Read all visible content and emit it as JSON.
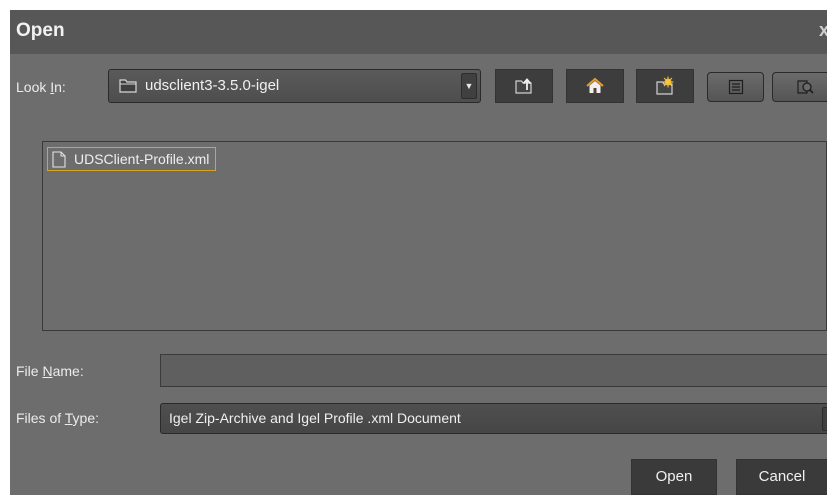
{
  "dialog": {
    "title": "Open",
    "close_glyph": "x"
  },
  "look_in": {
    "label_before": "Look ",
    "label_mnemonic": "I",
    "label_after": "n:",
    "selected_folder": "udsclient3-3.5.0-igel",
    "folder_icon": "folder-icon",
    "dropdown_glyph": "▼"
  },
  "toolbar": {
    "buttons": [
      {
        "icon": "up-one-level-icon"
      },
      {
        "icon": "home-icon"
      },
      {
        "icon": "new-folder-icon"
      },
      {
        "icon": "list-view-icon"
      },
      {
        "icon": "details-view-icon"
      }
    ]
  },
  "files": [
    {
      "name": "UDSClient-Profile.xml",
      "icon": "file-icon",
      "selected": true
    }
  ],
  "file_name": {
    "label_before": "File ",
    "label_mnemonic": "N",
    "label_after": "ame:",
    "value": ""
  },
  "files_of_type": {
    "label_before": "Files of ",
    "label_mnemonic": "T",
    "label_after": "ype:",
    "selected": "Igel Zip-Archive and Igel Profile .xml Document",
    "dropdown_glyph": "▼"
  },
  "buttons": {
    "open_label": "Open",
    "cancel_label": "Cancel"
  },
  "colors": {
    "dialog_bg": "#6d6d6d",
    "titlebar_bg": "#575757",
    "selection_border": "#d9a520"
  }
}
